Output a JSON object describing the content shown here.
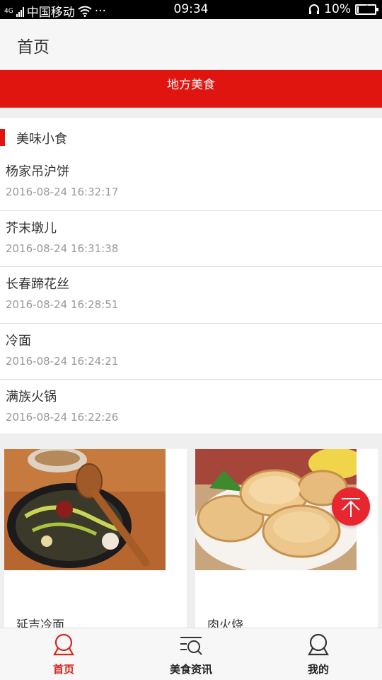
{
  "status_bar": {
    "network": "4G",
    "carrier": "中国移动",
    "more": "···",
    "time": "09:34",
    "battery": "10%",
    "battery_level": 0.1
  },
  "header": {
    "title": "首页"
  },
  "banner": {
    "label": "地方美食",
    "color": "#e0150f"
  },
  "section": {
    "title": "美味小食",
    "items": [
      {
        "name": "杨家吊沪饼",
        "time": "2016-08-24 16:32:17"
      },
      {
        "name": "芥末墩儿",
        "time": "2016-08-24 16:31:38"
      },
      {
        "name": "长春蹄花丝",
        "time": "2016-08-24 16:28:51"
      },
      {
        "name": "冷面",
        "time": "2016-08-24 16:24:21"
      },
      {
        "name": "满族火锅",
        "time": "2016-08-24 16:22:26"
      }
    ]
  },
  "cards": [
    {
      "name": "延吉冷面",
      "image": "cold-noodles-photo"
    },
    {
      "name": "肉火烧",
      "image": "meat-pancake-photo"
    }
  ],
  "fab": {
    "icon": "back-to-top-icon"
  },
  "tabbar": {
    "active_color": "#d9251c",
    "tabs": [
      {
        "label": "首页",
        "icon": "home-icon",
        "active": true
      },
      {
        "label": "美食资讯",
        "icon": "news-search-icon",
        "active": false
      },
      {
        "label": "我的",
        "icon": "profile-icon",
        "active": false
      }
    ]
  }
}
